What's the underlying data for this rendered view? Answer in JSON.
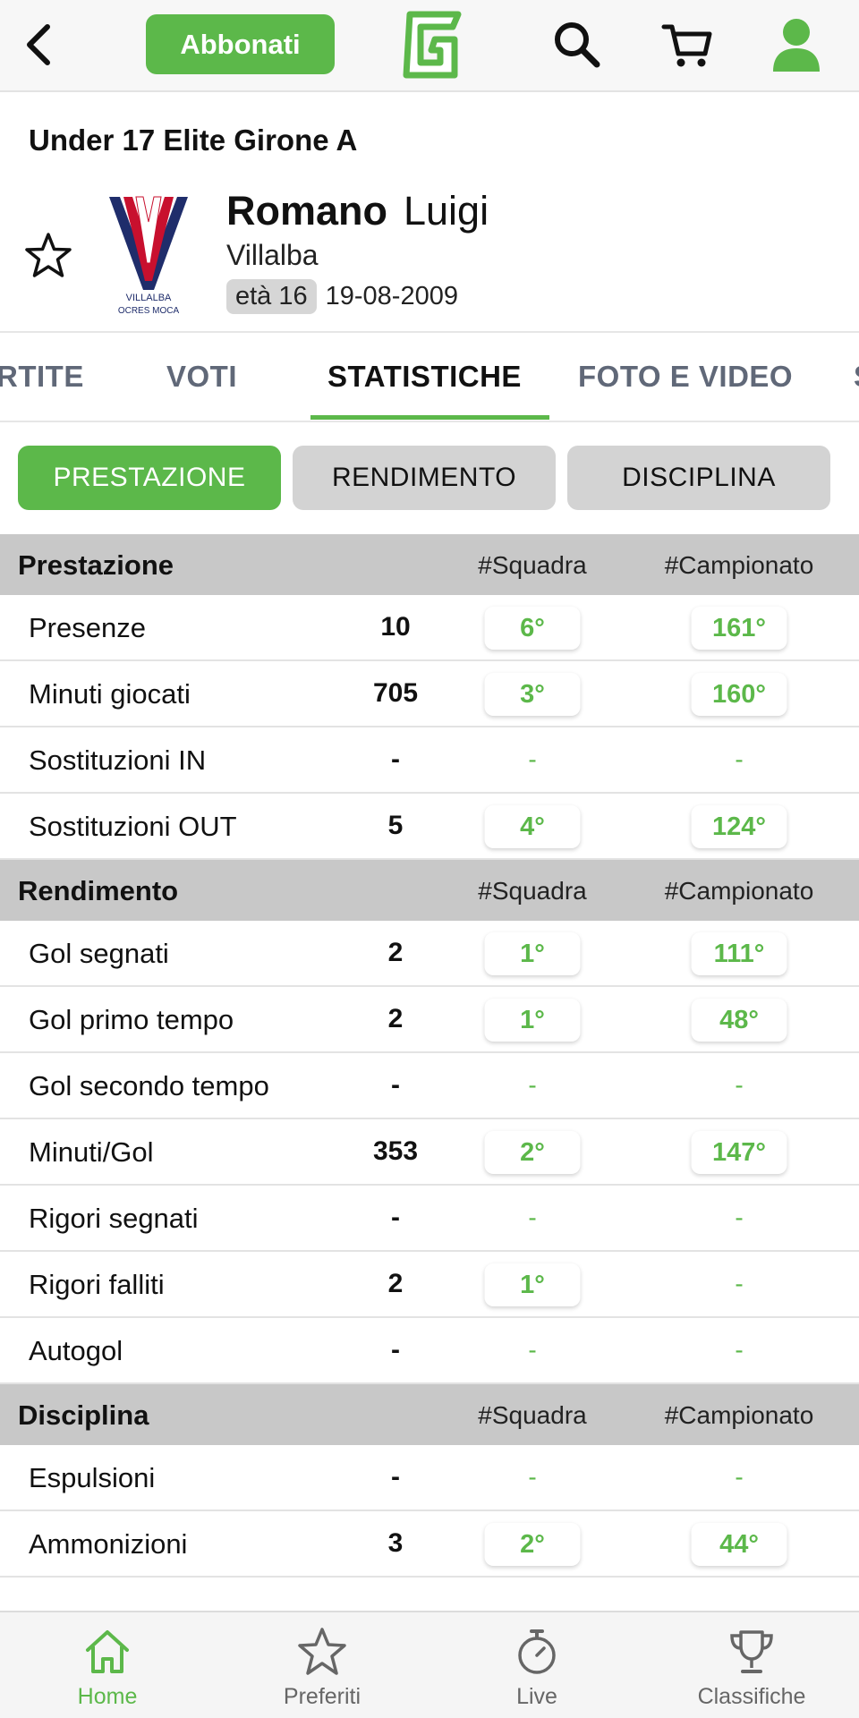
{
  "topbar": {
    "subscribe_label": "Abbonati",
    "icons": [
      "back-icon",
      "logo-g",
      "search-icon",
      "cart-icon",
      "user-icon"
    ]
  },
  "header": {
    "league": "Under 17 Elite  Girone A",
    "surname": "Romano",
    "first_name": "Luigi",
    "team": "Villalba",
    "age": "età 16",
    "birthdate": "19-08-2009"
  },
  "tabs": [
    {
      "label": "RTITE"
    },
    {
      "label": "VOTI"
    },
    {
      "label": "STATISTICHE",
      "active": true
    },
    {
      "label": "FOTO E VIDEO"
    },
    {
      "label": "S"
    }
  ],
  "segments": [
    {
      "label": "PRESTAZIONE",
      "active": true
    },
    {
      "label": "RENDIMENTO"
    },
    {
      "label": "DISCIPLINA"
    }
  ],
  "columns": {
    "team": "#Squadra",
    "league": "#Campionato"
  },
  "sections": [
    {
      "title": "Prestazione",
      "rows": [
        {
          "label": "Presenze",
          "value": "10",
          "team_rank": "6°",
          "league_rank": "161°"
        },
        {
          "label": "Minuti giocati",
          "value": "705",
          "team_rank": "3°",
          "league_rank": "160°"
        },
        {
          "label": "Sostituzioni IN",
          "value": "-",
          "team_rank": "-",
          "league_rank": "-"
        },
        {
          "label": "Sostituzioni OUT",
          "value": "5",
          "team_rank": "4°",
          "league_rank": "124°"
        }
      ]
    },
    {
      "title": "Rendimento",
      "rows": [
        {
          "label": "Gol segnati",
          "value": "2",
          "team_rank": "1°",
          "league_rank": "111°"
        },
        {
          "label": "Gol primo tempo",
          "value": "2",
          "team_rank": "1°",
          "league_rank": "48°"
        },
        {
          "label": "Gol secondo tempo",
          "value": "-",
          "team_rank": "-",
          "league_rank": "-"
        },
        {
          "label": "Minuti/Gol",
          "value": "353",
          "team_rank": "2°",
          "league_rank": "147°"
        },
        {
          "label": "Rigori segnati",
          "value": "-",
          "team_rank": "-",
          "league_rank": "-"
        },
        {
          "label": "Rigori falliti",
          "value": "2",
          "team_rank": "1°",
          "league_rank": "-"
        },
        {
          "label": "Autogol",
          "value": "-",
          "team_rank": "-",
          "league_rank": "-"
        }
      ]
    },
    {
      "title": "Disciplina",
      "rows": [
        {
          "label": "Espulsioni",
          "value": "-",
          "team_rank": "-",
          "league_rank": "-"
        },
        {
          "label": "Ammonizioni",
          "value": "3",
          "team_rank": "2°",
          "league_rank": "44°"
        }
      ]
    }
  ],
  "bottom_nav": [
    {
      "label": "Home",
      "icon": "home-icon",
      "active": true
    },
    {
      "label": "Preferiti",
      "icon": "star-icon"
    },
    {
      "label": "Live",
      "icon": "stopwatch-icon"
    },
    {
      "label": "Classifiche",
      "icon": "trophy-icon"
    }
  ],
  "colors": {
    "accent": "#5cb84a",
    "header_bg": "#c8c8c8",
    "tab_inactive": "#606878"
  }
}
